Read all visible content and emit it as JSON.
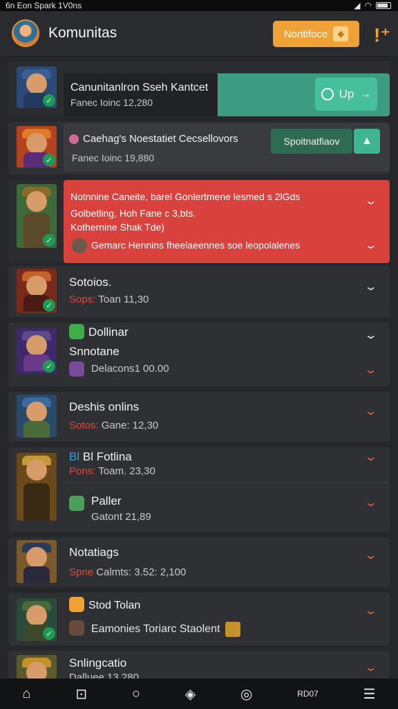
{
  "status": {
    "left": "6n Eon Spark 1V0ns",
    "icons": [
      "signal-icon",
      "wifi-icon",
      "battery-icon"
    ]
  },
  "header": {
    "title": "Komunitas",
    "notif_label": "Nontifoce",
    "colors": {
      "accent": "#f1a236"
    }
  },
  "rows": [
    {
      "title": "Canunitanlron Sseh Kantcet",
      "sub": "Fanec Ioinc 12,280",
      "action": "Up",
      "colors": {
        "panel": "#3b9c82",
        "button": "#3fb690"
      }
    },
    {
      "title": "Caehag's Noestatiet Cecsellovors",
      "sub": "Fanec Ioinc 19,880",
      "action": "Spoitnatfiaov",
      "colors": {
        "button": "#3fb690"
      }
    },
    {
      "lines": [
        "Notnnine Caneite, barel Gonlertmene lesmed s 2lGds",
        "Golbetling, Hoh Fane c 3,bts.",
        "Kothernine Shak Tde)",
        "Gemarc Hennins fheelaeennes soe leopolalenes"
      ],
      "colors": {
        "bg": "#d9413d"
      }
    },
    {
      "title": "Sotoios.",
      "sub_prefix": "Sops:",
      "sub": "Toan 11,30"
    },
    {
      "title": "Dollinar",
      "title2": "Snnotane",
      "sub": "Delacons1 00.00"
    },
    {
      "title": "Deshis onlins",
      "sub_prefix": "Sotos:",
      "sub": "Gane: 12,30"
    },
    {
      "title": "Bl Fotlina",
      "sub_prefix": "Pons:",
      "sub": "Toam. 23,30",
      "title2": "Paller",
      "sub2": "Gatont 21,89"
    },
    {
      "title": "Notatiags",
      "sub_prefix": "Spne",
      "sub": "Calmts: 3.52: 2,100"
    },
    {
      "title": "Stod Tolan",
      "sub": "Eamonies Toriarc Staolent"
    },
    {
      "title": "Snlingcatio",
      "sub": "Dalluee 13,280"
    }
  ],
  "nav": [
    "home-icon",
    "alert-box-icon",
    "circle-icon",
    "map-icon",
    "coin-icon",
    "Rank",
    "menu-icon"
  ],
  "nav_text": {
    "rank": "RD07"
  }
}
